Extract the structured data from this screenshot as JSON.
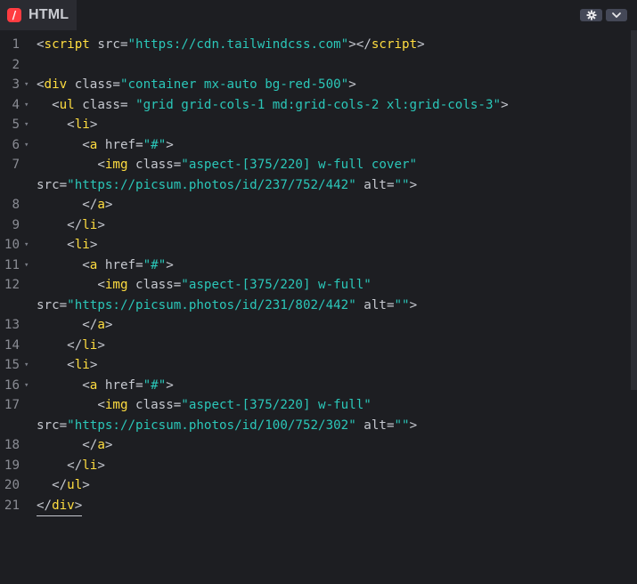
{
  "panel": {
    "title": "HTML",
    "badge": "/",
    "accent_color": "#ff3c41",
    "buttons": [
      {
        "name": "settings",
        "icon": "gear-icon"
      },
      {
        "name": "collapse",
        "icon": "chevron-down-icon"
      }
    ]
  },
  "code": {
    "lines": [
      {
        "n": "1",
        "fold": false,
        "tokens": [
          [
            "punc",
            "<"
          ],
          [
            "tag",
            "script"
          ],
          [
            "attr",
            " src"
          ],
          [
            "punc",
            "="
          ],
          [
            "str",
            "\"https://cdn.tailwindcss.com\""
          ],
          [
            "punc",
            "></"
          ],
          [
            "tag",
            "script"
          ],
          [
            "punc",
            ">"
          ]
        ]
      },
      {
        "n": "2",
        "fold": false,
        "tokens": []
      },
      {
        "n": "3",
        "fold": true,
        "tokens": [
          [
            "punc",
            "<"
          ],
          [
            "tag",
            "div"
          ],
          [
            "attr",
            " class"
          ],
          [
            "punc",
            "="
          ],
          [
            "str",
            "\"container mx-auto bg-red-500\""
          ],
          [
            "punc",
            ">"
          ]
        ]
      },
      {
        "n": "4",
        "fold": true,
        "tokens": [
          [
            "punc",
            "  <"
          ],
          [
            "tag",
            "ul"
          ],
          [
            "attr",
            " class"
          ],
          [
            "punc",
            "= "
          ],
          [
            "str",
            "\"grid grid-cols-1 md:grid-cols-2 xl:grid-cols-3\""
          ],
          [
            "punc",
            ">"
          ]
        ]
      },
      {
        "n": "5",
        "fold": true,
        "tokens": [
          [
            "punc",
            "    <"
          ],
          [
            "tag",
            "li"
          ],
          [
            "punc",
            ">"
          ]
        ]
      },
      {
        "n": "6",
        "fold": true,
        "tokens": [
          [
            "punc",
            "      <"
          ],
          [
            "tag",
            "a"
          ],
          [
            "attr",
            " href"
          ],
          [
            "punc",
            "="
          ],
          [
            "str",
            "\"#\""
          ],
          [
            "punc",
            ">"
          ]
        ]
      },
      {
        "n": "7",
        "fold": false,
        "tokens": [
          [
            "punc",
            "        <"
          ],
          [
            "tag",
            "img"
          ],
          [
            "attr",
            " class"
          ],
          [
            "punc",
            "="
          ],
          [
            "str",
            "\"aspect-[375/220] w-full cover\""
          ]
        ]
      },
      {
        "n": "",
        "fold": false,
        "tokens": [
          [
            "attr",
            "src"
          ],
          [
            "punc",
            "="
          ],
          [
            "str",
            "\"https://picsum.photos/id/237/752/442\""
          ],
          [
            "attr",
            " alt"
          ],
          [
            "punc",
            "="
          ],
          [
            "str",
            "\"\""
          ],
          [
            "punc",
            ">"
          ]
        ]
      },
      {
        "n": "8",
        "fold": false,
        "tokens": [
          [
            "punc",
            "      </"
          ],
          [
            "tag",
            "a"
          ],
          [
            "punc",
            ">"
          ]
        ]
      },
      {
        "n": "9",
        "fold": false,
        "tokens": [
          [
            "punc",
            "    </"
          ],
          [
            "tag",
            "li"
          ],
          [
            "punc",
            ">"
          ]
        ]
      },
      {
        "n": "10",
        "fold": true,
        "tokens": [
          [
            "punc",
            "    <"
          ],
          [
            "tag",
            "li"
          ],
          [
            "punc",
            ">"
          ]
        ]
      },
      {
        "n": "11",
        "fold": true,
        "tokens": [
          [
            "punc",
            "      <"
          ],
          [
            "tag",
            "a"
          ],
          [
            "attr",
            " href"
          ],
          [
            "punc",
            "="
          ],
          [
            "str",
            "\"#\""
          ],
          [
            "punc",
            ">"
          ]
        ]
      },
      {
        "n": "12",
        "fold": false,
        "tokens": [
          [
            "punc",
            "        <"
          ],
          [
            "tag",
            "img"
          ],
          [
            "attr",
            " class"
          ],
          [
            "punc",
            "="
          ],
          [
            "str",
            "\"aspect-[375/220] w-full\""
          ]
        ]
      },
      {
        "n": "",
        "fold": false,
        "tokens": [
          [
            "attr",
            "src"
          ],
          [
            "punc",
            "="
          ],
          [
            "str",
            "\"https://picsum.photos/id/231/802/442\""
          ],
          [
            "attr",
            " alt"
          ],
          [
            "punc",
            "="
          ],
          [
            "str",
            "\"\""
          ],
          [
            "punc",
            ">"
          ]
        ]
      },
      {
        "n": "13",
        "fold": false,
        "tokens": [
          [
            "punc",
            "      </"
          ],
          [
            "tag",
            "a"
          ],
          [
            "punc",
            ">"
          ]
        ]
      },
      {
        "n": "14",
        "fold": false,
        "tokens": [
          [
            "punc",
            "    </"
          ],
          [
            "tag",
            "li"
          ],
          [
            "punc",
            ">"
          ]
        ]
      },
      {
        "n": "15",
        "fold": true,
        "tokens": [
          [
            "punc",
            "    <"
          ],
          [
            "tag",
            "li"
          ],
          [
            "punc",
            ">"
          ]
        ]
      },
      {
        "n": "16",
        "fold": true,
        "tokens": [
          [
            "punc",
            "      <"
          ],
          [
            "tag",
            "a"
          ],
          [
            "attr",
            " href"
          ],
          [
            "punc",
            "="
          ],
          [
            "str",
            "\"#\""
          ],
          [
            "punc",
            ">"
          ]
        ]
      },
      {
        "n": "17",
        "fold": false,
        "tokens": [
          [
            "punc",
            "        <"
          ],
          [
            "tag",
            "img"
          ],
          [
            "attr",
            " class"
          ],
          [
            "punc",
            "="
          ],
          [
            "str",
            "\"aspect-[375/220] w-full\""
          ]
        ]
      },
      {
        "n": "",
        "fold": false,
        "tokens": [
          [
            "attr",
            "src"
          ],
          [
            "punc",
            "="
          ],
          [
            "str",
            "\"https://picsum.photos/id/100/752/302\""
          ],
          [
            "attr",
            " alt"
          ],
          [
            "punc",
            "="
          ],
          [
            "str",
            "\"\""
          ],
          [
            "punc",
            ">"
          ]
        ]
      },
      {
        "n": "18",
        "fold": false,
        "tokens": [
          [
            "punc",
            "      </"
          ],
          [
            "tag",
            "a"
          ],
          [
            "punc",
            ">"
          ]
        ]
      },
      {
        "n": "19",
        "fold": false,
        "tokens": [
          [
            "punc",
            "    </"
          ],
          [
            "tag",
            "li"
          ],
          [
            "punc",
            ">"
          ]
        ]
      },
      {
        "n": "20",
        "fold": false,
        "tokens": [
          [
            "punc",
            "  </"
          ],
          [
            "tag",
            "ul"
          ],
          [
            "punc",
            ">"
          ]
        ]
      },
      {
        "n": "21",
        "fold": false,
        "tokens": [
          [
            "punc",
            "</"
          ],
          [
            "tag",
            "div"
          ],
          [
            "punc",
            ">"
          ]
        ]
      }
    ]
  }
}
